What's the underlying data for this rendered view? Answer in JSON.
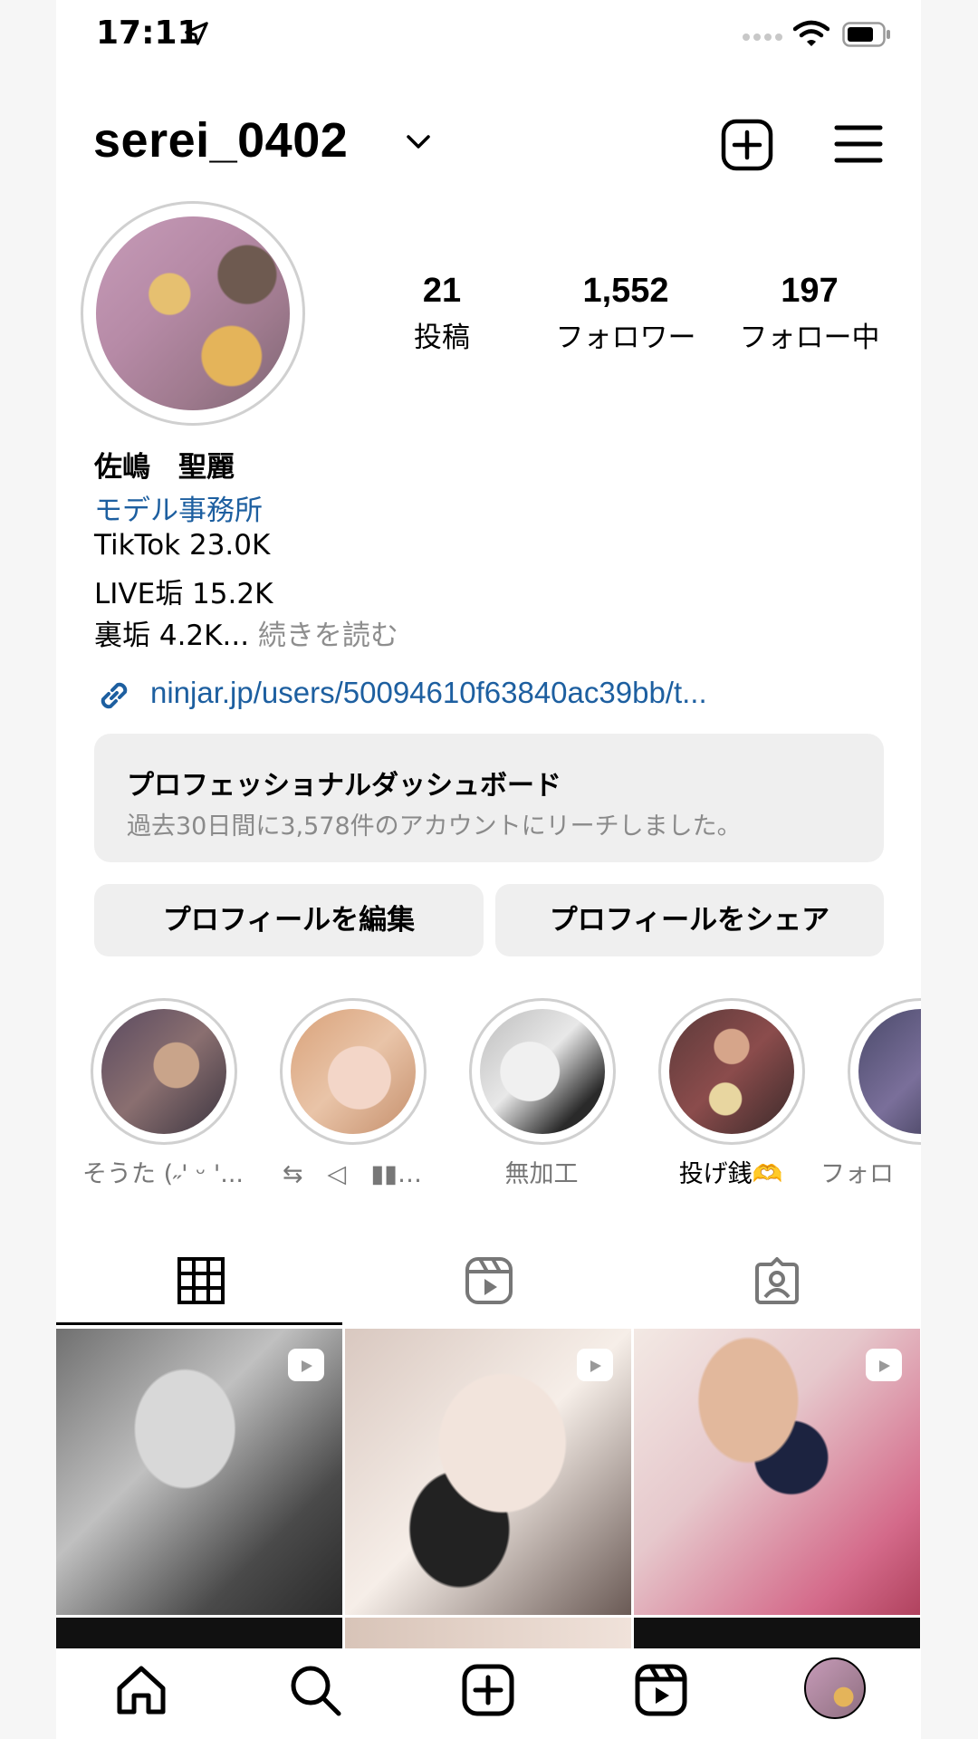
{
  "status_bar": {
    "time": "17:11"
  },
  "header": {
    "username": "serei_0402"
  },
  "stats": [
    {
      "value": "21",
      "label": "投稿"
    },
    {
      "value": "1,552",
      "label": "フォロワー"
    },
    {
      "value": "197",
      "label": "フォロー中"
    }
  ],
  "bio": {
    "name": "佐嶋　聖麗",
    "category": "モデル事務所",
    "line1": "TikTok 23.0K",
    "line2": "LIVE垢 15.2K",
    "line3": "裏垢 4.2K...",
    "more": " 続きを読む",
    "link": "ninjar.jp/users/50094610f63840ac39bb/t..."
  },
  "dashboard": {
    "title": "プロフェッショナルダッシュボード",
    "subtitle": "過去30日間に3,578件のアカウントにリーチしました。"
  },
  "buttons": {
    "edit": "プロフィールを編集",
    "share": "プロフィールをシェア"
  },
  "highlights": [
    {
      "label": "そうた (˶' ᵕ '..."
    },
    {
      "label": "⇆　◁　▮▮…"
    },
    {
      "label": "無加工"
    },
    {
      "label": "投げ銭🫶"
    },
    {
      "label": "フォロ"
    }
  ],
  "icons": {
    "location": "location-arrow-icon",
    "wifi": "wifi-icon",
    "battery": "battery-icon",
    "create": "plus-square-icon",
    "menu": "hamburger-menu-icon",
    "grid": "grid-icon",
    "reels": "reels-icon",
    "tagged": "tagged-user-icon",
    "home": "home-icon",
    "search": "search-icon"
  },
  "colors": {
    "link": "#1d5fa0",
    "muted": "#8e8e8e",
    "button_bg": "#efefef"
  }
}
